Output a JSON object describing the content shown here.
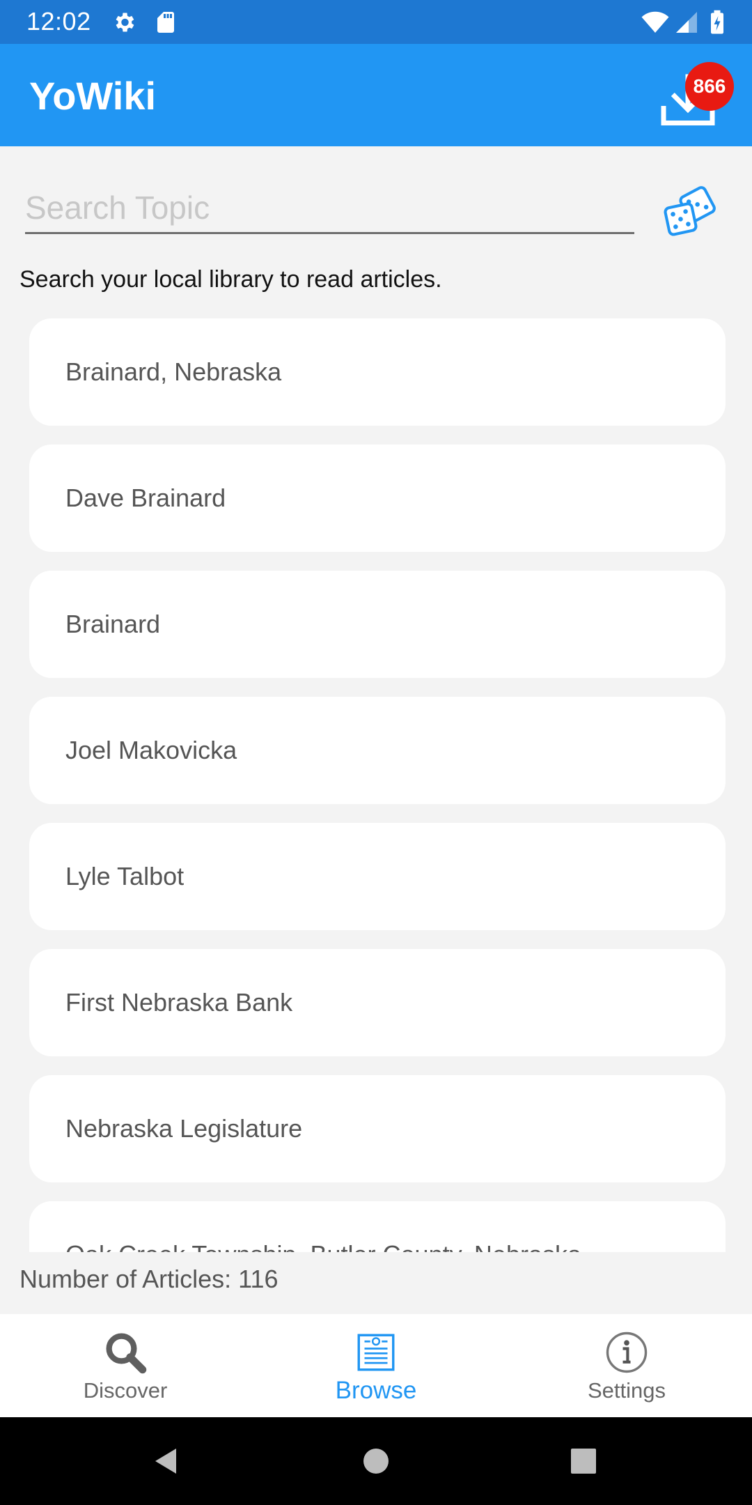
{
  "status_bar": {
    "time": "12:02",
    "icons": [
      "gear-icon",
      "sd-card-icon",
      "wifi-icon",
      "signal-icon",
      "battery-icon"
    ]
  },
  "app_bar": {
    "title": "YoWiki",
    "download_badge": "866"
  },
  "search": {
    "placeholder": "Search Topic",
    "value": "",
    "random_icon": "dice-icon"
  },
  "hint": "Search your local library to read articles.",
  "articles": [
    "Brainard, Nebraska",
    "Dave Brainard",
    "Brainard",
    "Joel Makovicka",
    "Lyle Talbot",
    "First Nebraska Bank",
    "Nebraska Legislature",
    "Oak Creek Township, Butler County, Nebraska"
  ],
  "footer": {
    "article_count": "Number of Articles: 116"
  },
  "bottom_nav": {
    "discover": "Discover",
    "browse": "Browse",
    "settings": "Settings",
    "active": "browse"
  },
  "colors": {
    "status_bar": "#1e78d2",
    "app_bar": "#2196f3",
    "badge": "#e81a12",
    "accent": "#2196f3",
    "background": "#f3f3f3"
  }
}
